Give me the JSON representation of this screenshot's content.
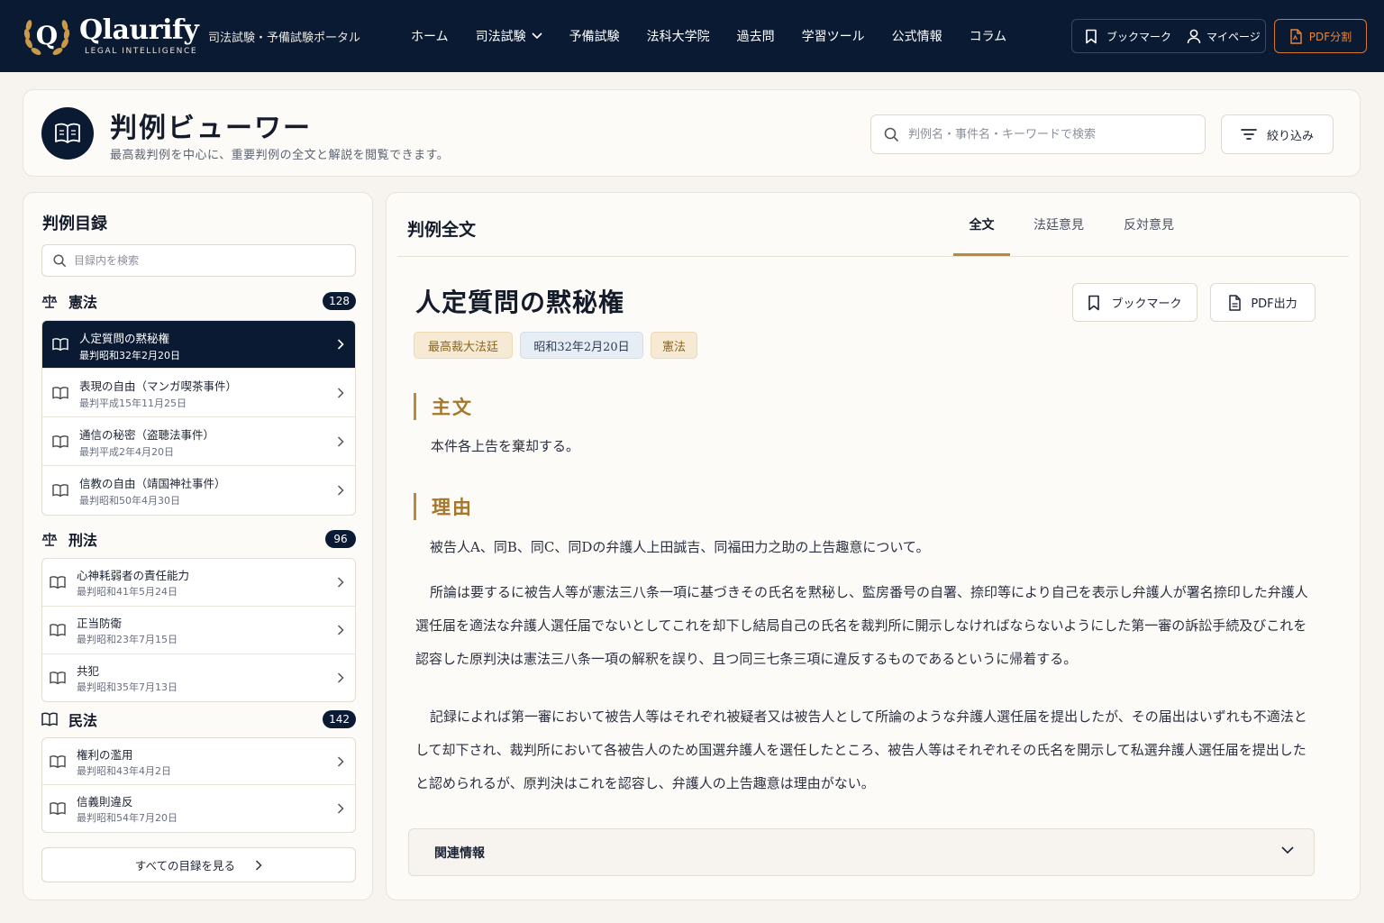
{
  "header": {
    "brand_name": "Qlaurify",
    "brand_sub": "LEGAL INTELLIGENCE",
    "portal_label": "司法試験・予備試験ポータル",
    "nav": [
      "ホーム",
      "司法試験",
      "予備試験",
      "法科大学院",
      "過去問",
      "学習ツール",
      "公式情報",
      "コラム"
    ],
    "bookmark_label": "ブックマーク",
    "mypage_label": "マイページ",
    "pdf_split_label": "PDF分割"
  },
  "title_card": {
    "title": "判例ビューワー",
    "subtitle": "最高裁判例を中心に、重要判例の全文と解説を閲覧できます。",
    "search_placeholder": "判例名・事件名・キーワードで検索",
    "filter_label": "絞り込み"
  },
  "sidebar": {
    "title": "判例目録",
    "search_placeholder": "目録内を検索",
    "categories": [
      {
        "name": "憲法",
        "count": "128",
        "items": [
          {
            "title": "人定質問の黙秘権",
            "date": "最判昭和32年2月20日"
          },
          {
            "title": "表現の自由（マンガ喫茶事件）",
            "date": "最判平成15年11月25日"
          },
          {
            "title": "通信の秘密（盗聴法事件）",
            "date": "最判平成2年4月20日"
          },
          {
            "title": "信教の自由（靖国神社事件）",
            "date": "最判昭和50年4月30日"
          }
        ]
      },
      {
        "name": "刑法",
        "count": "96",
        "items": [
          {
            "title": "心神耗弱者の責任能力",
            "date": "最判昭和41年5月24日"
          },
          {
            "title": "正当防衛",
            "date": "最判昭和23年7月15日"
          },
          {
            "title": "共犯",
            "date": "最判昭和35年7月13日"
          }
        ]
      },
      {
        "name": "民法",
        "count": "142",
        "items": [
          {
            "title": "権利の濫用",
            "date": "最判昭和43年4月2日"
          },
          {
            "title": "信義則違反",
            "date": "最判昭和54年7月20日"
          }
        ]
      }
    ],
    "see_all_label": "すべての目録を見る"
  },
  "main": {
    "panel_title": "判例全文",
    "tabs": [
      "全文",
      "法廷意見",
      "反対意見"
    ],
    "case_title": "人定質問の黙秘権",
    "bookmark_label": "ブックマーク",
    "pdf_export_label": "PDF出力",
    "tags": [
      "最高裁大法廷",
      "昭和32年2月20日",
      "憲法"
    ],
    "sections": {
      "main_text_heading": "主文",
      "main_text": "本件各上告を棄却する。",
      "reason_heading": "理由",
      "reason_paragraphs": [
        "被告人A、同B、同C、同Dの弁護人上田誠吉、同福田力之助の上告趣意について。",
        "所論は要するに被告人等が憲法三八条一項に基づきその氏名を黙秘し、監房番号の自署、捺印等により自己を表示し弁護人が署名捺印した弁護人選任届を適法な弁護人選任届でないとしてこれを却下し結局自己の氏名を裁判所に開示しなければならないようにした第一審の訴訟手続及びこれを認容した原判決は憲法三八条一項の解釈を誤り、且つ同三七条三項に違反するものであるというに帰着する。",
        "記録によれば第一審において被告人等はそれぞれ被疑者又は被告人として所論のような弁護人選任届を提出したが、その届出はいずれも不適法として却下され、裁判所において各被告人のため国選弁護人を選任したところ、被告人等はそれぞれその氏名を開示して私選弁護人選任届を提出したと認められるが、原判決はこれを認容し、弁護人の上告趣意は理由がない。"
      ]
    },
    "related_label": "関連情報"
  },
  "colors": {
    "navy": "#0b1a33",
    "gold": "#b78b3c",
    "orange": "#d8782a"
  }
}
